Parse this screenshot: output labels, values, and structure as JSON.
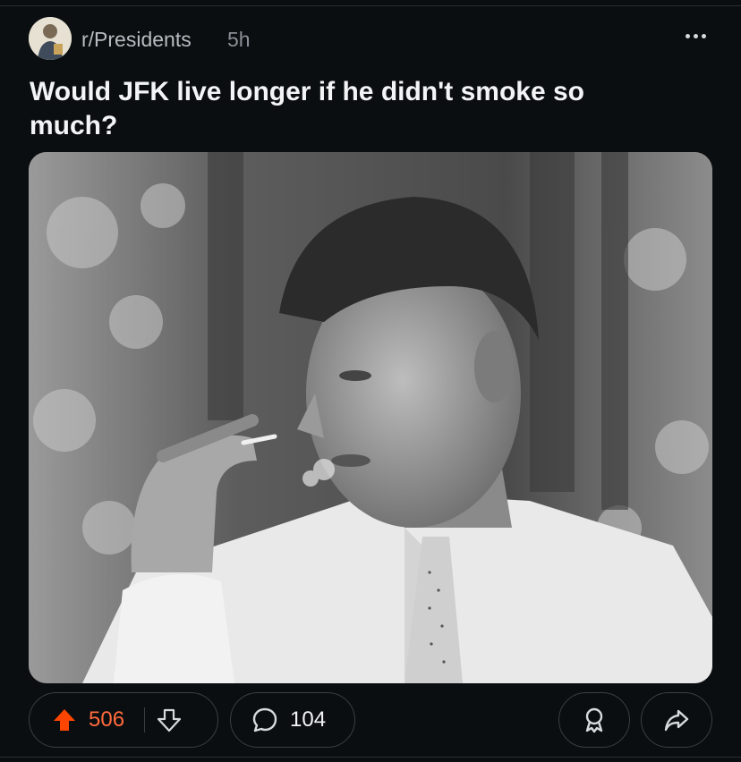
{
  "post": {
    "subreddit": "r/Presidents",
    "age": "5h",
    "title": "Would JFK live longer if he didn't smoke so much?",
    "score": "506",
    "comment_count": "104"
  },
  "icons": {
    "more": "more-horizontal-icon",
    "upvote": "upvote-arrow-icon",
    "downvote": "downvote-arrow-icon",
    "comment": "comment-bubble-icon",
    "award": "award-icon",
    "share": "share-arrow-icon"
  },
  "colors": {
    "background": "#0b0e11",
    "upvote_active": "#ff4500",
    "score_active": "#ff6a3c",
    "text": "#f2f4f5"
  }
}
